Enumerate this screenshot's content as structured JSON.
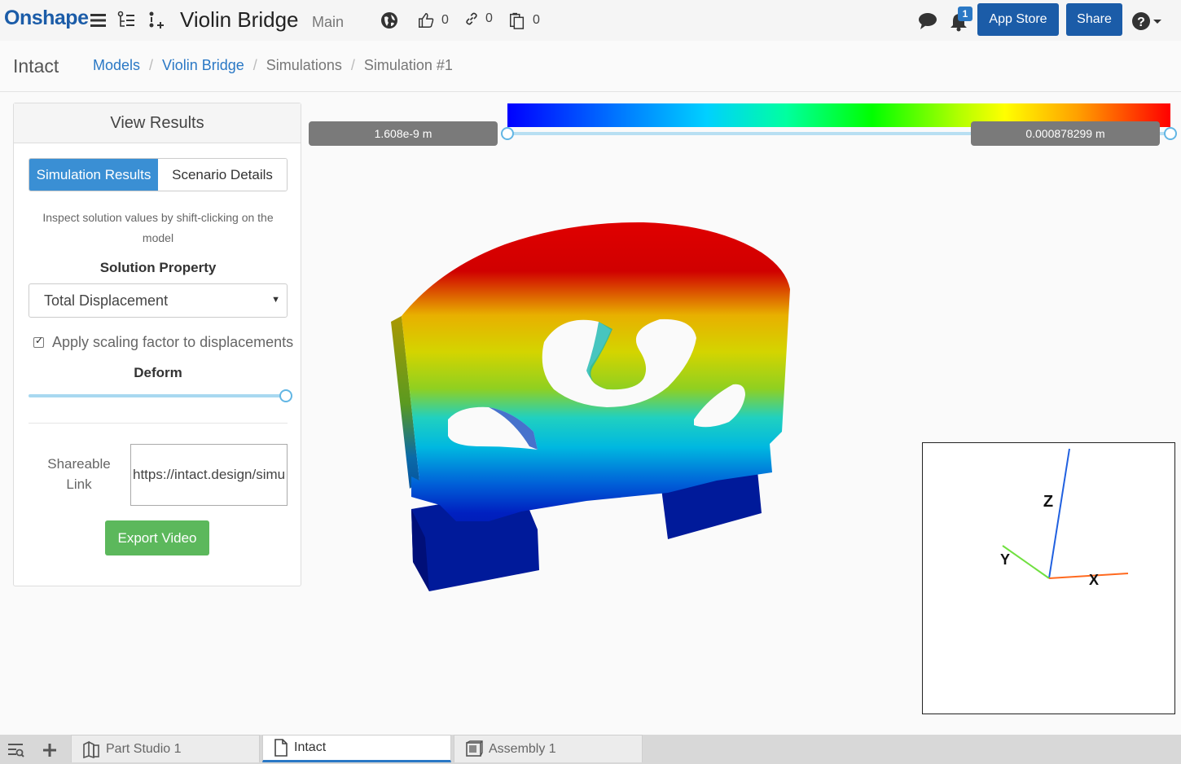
{
  "header": {
    "logo": "Onshape",
    "doc_title": "Violin Bridge",
    "branch": "Main",
    "likes": "0",
    "links": "0",
    "copies": "0",
    "notifications": "1",
    "app_store_label": "App Store",
    "share_label": "Share",
    "icons": [
      "hamburger-icon",
      "feature-tree-icon",
      "add-feature-icon",
      "globe-icon",
      "thumbs-up-icon",
      "link-icon",
      "copy-icon",
      "chat-icon",
      "bell-icon",
      "help-icon"
    ]
  },
  "crumbbar": {
    "app_name": "Intact",
    "crumbs": [
      "Models",
      "Violin Bridge",
      "Simulations",
      "Simulation #1"
    ]
  },
  "panel": {
    "title": "View Results",
    "tabs": [
      "Simulation Results",
      "Scenario Details"
    ],
    "hint": "Inspect solution values by shift-clicking on the model",
    "solution_property_label": "Solution Property",
    "solution_property_value": "Total Displacement",
    "apply_scaling_label": "Apply scaling factor to displacements",
    "apply_scaling_checked": true,
    "deform_label": "Deform",
    "deform_fraction": 1.0,
    "shareable_link_label": "Shareable Link",
    "shareable_link_value": "https://intact.design/simu",
    "export_label": "Export Video"
  },
  "legend": {
    "min_label": "1.608e-9 m",
    "max_label": "0.000878299 m"
  },
  "triad": {
    "x_label": "X",
    "y_label": "Y",
    "z_label": "Z"
  },
  "bottom_tabs": [
    {
      "label": "Part Studio 1",
      "icon": "part-studio-icon"
    },
    {
      "label": "Intact",
      "icon": "document-icon",
      "active": true
    },
    {
      "label": "Assembly 1",
      "icon": "assembly-icon"
    }
  ],
  "colors": {
    "brand": "#1b5ca8",
    "active_tab": "#3a8fd4",
    "export": "#5cb85c"
  }
}
